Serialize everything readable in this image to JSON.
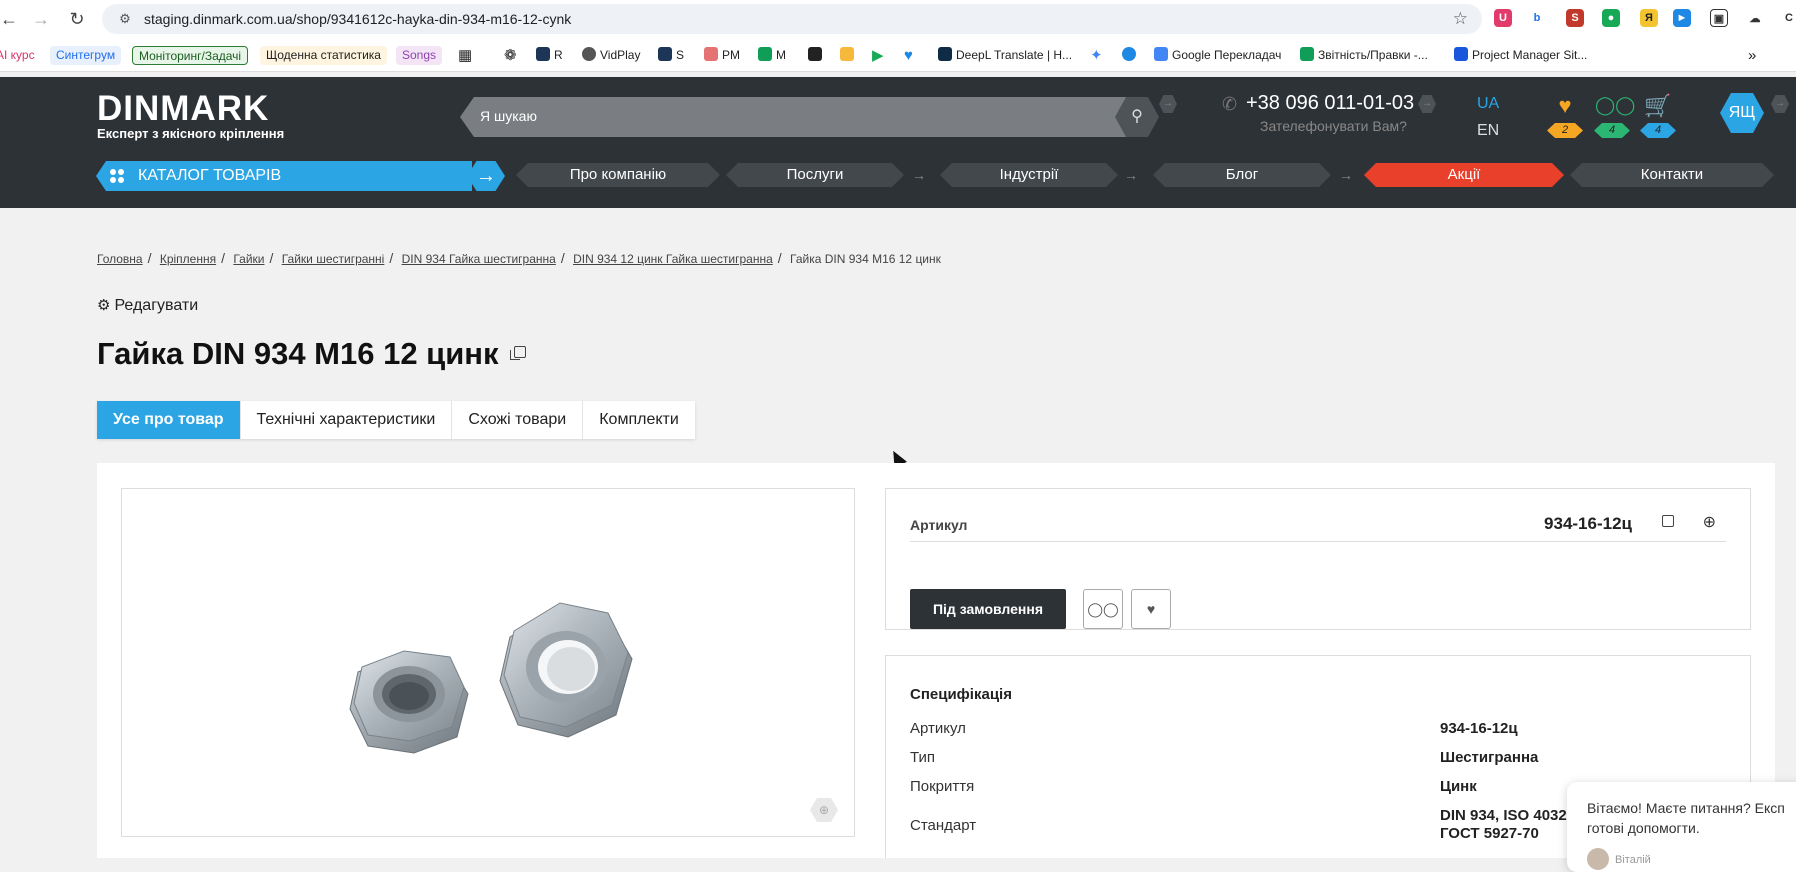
{
  "browser": {
    "url": "staging.dinmark.com.ua/shop/9341612c-hayka-din-934-m16-12-cynk",
    "bookmarks": [
      {
        "label": "AI курс",
        "color": "#d6336c"
      },
      {
        "label": "Синтегрум",
        "color": "#1f6feb"
      },
      {
        "label": "Моніторинг/Задачі",
        "color": "#2e7d32"
      },
      {
        "label": "Щоденна статистика",
        "color": "#b26a00"
      },
      {
        "label": "Songs",
        "color": "#8e44ad"
      },
      {
        "label": "R"
      },
      {
        "label": "VidPlay"
      },
      {
        "label": "S"
      },
      {
        "label": "PM"
      },
      {
        "label": "M"
      },
      {
        "label": "DeepL Translate | H..."
      },
      {
        "label": "Google Перекладач"
      },
      {
        "label": "Звітність/Правки -..."
      },
      {
        "label": "Project Manager Sit..."
      }
    ]
  },
  "header": {
    "logo_word": "DINMARK",
    "logo_tagline": "Експерт з якісного кріплення",
    "search_placeholder": "Я шукаю",
    "phone": "+38 096 011-01-03",
    "callback": "Зателефонувати Вам?",
    "lang_active": "UA",
    "lang_other": "EN",
    "counters": {
      "favorites": "2",
      "compare": "4",
      "cart": "4"
    },
    "user_initials": "ЯЩ",
    "catalog_label": "КАТАЛОГ ТОВАРІВ",
    "menu": [
      "Про компанію",
      "Послуги",
      "Індустрії",
      "Блог",
      "Акції",
      "Контакти"
    ]
  },
  "colors": {
    "accent": "#2ba5e3",
    "promo": "#e8402a",
    "header_bg": "#2d3237",
    "fav_badge": "#f5a623",
    "compare_badge": "#2bb673",
    "cart_badge": "#2ba5e3"
  },
  "breadcrumb": [
    "Головна",
    "Кріплення",
    "Гайки",
    "Гайки шестигранні",
    "DIN 934 Гайка шестигранна",
    "DIN 934 12 цинк Гайка шестигранна",
    "Гайка DIN 934 M16 12 цинк"
  ],
  "page": {
    "edit_label": "Редагувати",
    "title": "Гайка DIN 934 M16 12 цинк",
    "tabs": [
      "Усе про товар",
      "Технічні характеристики",
      "Схожі товари",
      "Комплекти"
    ]
  },
  "product": {
    "sku_label": "Артикул",
    "sku_value": "934-16-12ц",
    "order_button": "Під замовлення",
    "spec_title": "Специфікація",
    "specs": [
      {
        "key": "Артикул",
        "value": "934-16-12ц"
      },
      {
        "key": "Тип",
        "value": "Шестигранна"
      },
      {
        "key": "Покриття",
        "value": "Цинк"
      },
      {
        "key": "Стандарт",
        "value": "DIN 934, ISO 4032, ГОСТ 5927-70"
      }
    ]
  },
  "chat": {
    "message": "Вітаємо! Маєте питання? Експ готові допомогти.",
    "agent": "Віталій"
  }
}
